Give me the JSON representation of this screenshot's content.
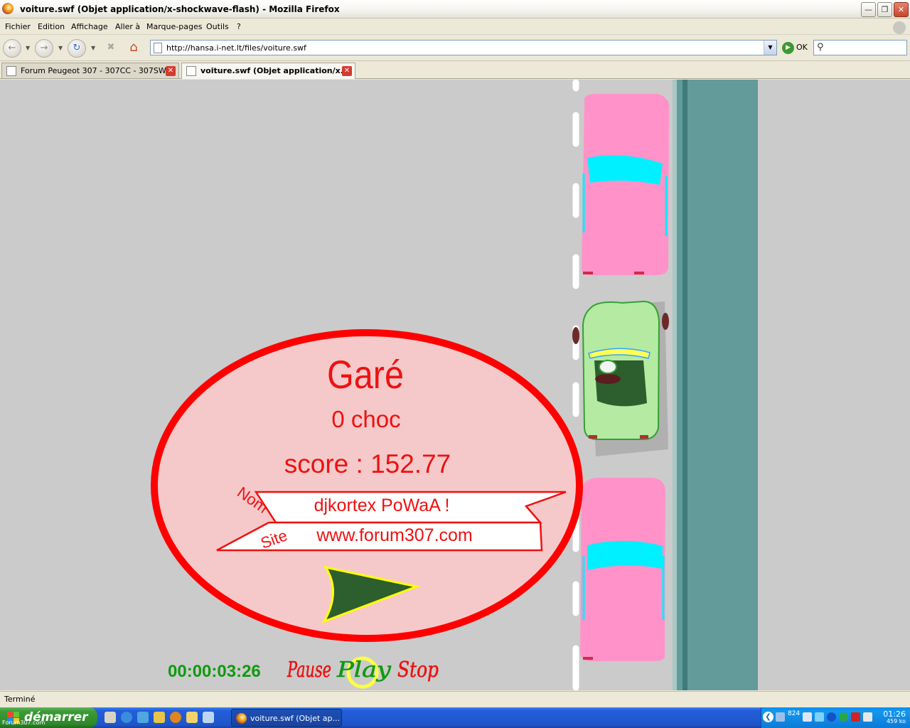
{
  "window": {
    "title": "voiture.swf (Objet application/x-shockwave-flash) - Mozilla Firefox"
  },
  "menu": [
    "Fichier",
    "Edition",
    "Affichage",
    "Aller à",
    "Marque-pages",
    "Outils",
    "?"
  ],
  "nav": {
    "url": "http://hansa.i-net.lt/files/voiture.swf",
    "go_label": "OK"
  },
  "tabs": [
    {
      "label": "Forum Peugeot 307 - 307CC - 307SW,...",
      "active": false
    },
    {
      "label": "voiture.swf (Objet application/x...",
      "active": true
    }
  ],
  "game": {
    "result_title": "Garé",
    "collisions": "0 choc",
    "score": "score : 152.77",
    "name_label": "Nom",
    "name_value": "djkortex PoWaA !",
    "site_label": "Site",
    "site_value": "www.forum307.com",
    "timer": "00:00:03:26",
    "pause_label": "Pause",
    "play_label": "Play",
    "stop_label": "Stop",
    "colors": {
      "road": "#cbcbcb",
      "parked_car": "#ff93c9",
      "windshield": "#00f0ff",
      "player_car": "#b4eaa2",
      "sidewalk": "#639a9a",
      "panel_fill": "#f5c9c9",
      "panel_stroke": "#ff0000",
      "text_red": "#ee1111",
      "timer_green": "#119911",
      "arrow_green": "#2d5e2d",
      "arrow_outline": "#ffff00"
    }
  },
  "status": {
    "text": "Terminé"
  },
  "taskbar": {
    "start_label": "démarrer",
    "watermark": "Forum307.com",
    "task_item": "voiture.swf (Objet ap...",
    "tray_number": "824",
    "clock_time": "01:26",
    "clock_sub": "459 ko"
  }
}
